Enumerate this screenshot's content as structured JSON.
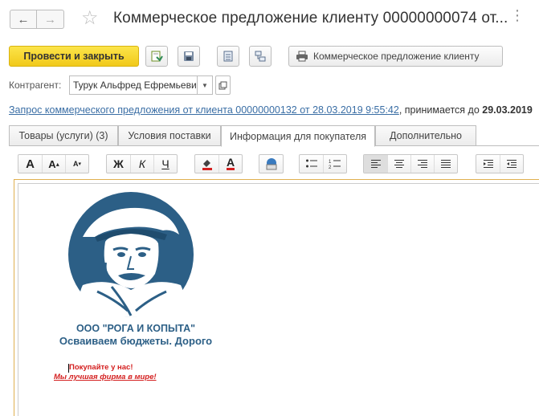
{
  "window": {
    "title": "Коммерческое предложение клиенту 00000000074 от...",
    "back_icon": "arrow-left-icon",
    "forward_icon": "arrow-right-icon",
    "favorite_icon": "star-icon",
    "more_icon": "ellipsis-icon"
  },
  "toolbar": {
    "post_close_label": "Провести и закрыть",
    "print_label": "Коммерческое предложение клиенту",
    "accent": "#f1c91a"
  },
  "counterparty": {
    "label": "Контрагент:",
    "value": "Турук Альфред Ефремьевич"
  },
  "request": {
    "link_text": "Запрос коммерческого предложения от клиента 00000000132 от 28.03.2019 9:55:42",
    "suffix": ", принимается до ",
    "deadline": "29.03.2019"
  },
  "tabs": [
    {
      "label": "Товары (услуги) (3)",
      "active": false
    },
    {
      "label": "Условия поставки",
      "active": false
    },
    {
      "label": "Информация для покупателя",
      "active": true
    },
    {
      "label": "Дополнительно",
      "active": false
    }
  ],
  "format_toolbar": {
    "font": "A",
    "bold": "Ж",
    "italic": "К",
    "underline": "Ч",
    "text_color": "A"
  },
  "editor": {
    "company_line1": "ООО \"РОГА И КОПЫТА\"",
    "company_line2": "Осваиваем бюджеты. Дорого",
    "slogan1": "Покупайте у нас!",
    "slogan2": "Мы лучшая фирма в мире!",
    "brand_color": "#2c5f86",
    "slogan_color": "#d42020"
  }
}
